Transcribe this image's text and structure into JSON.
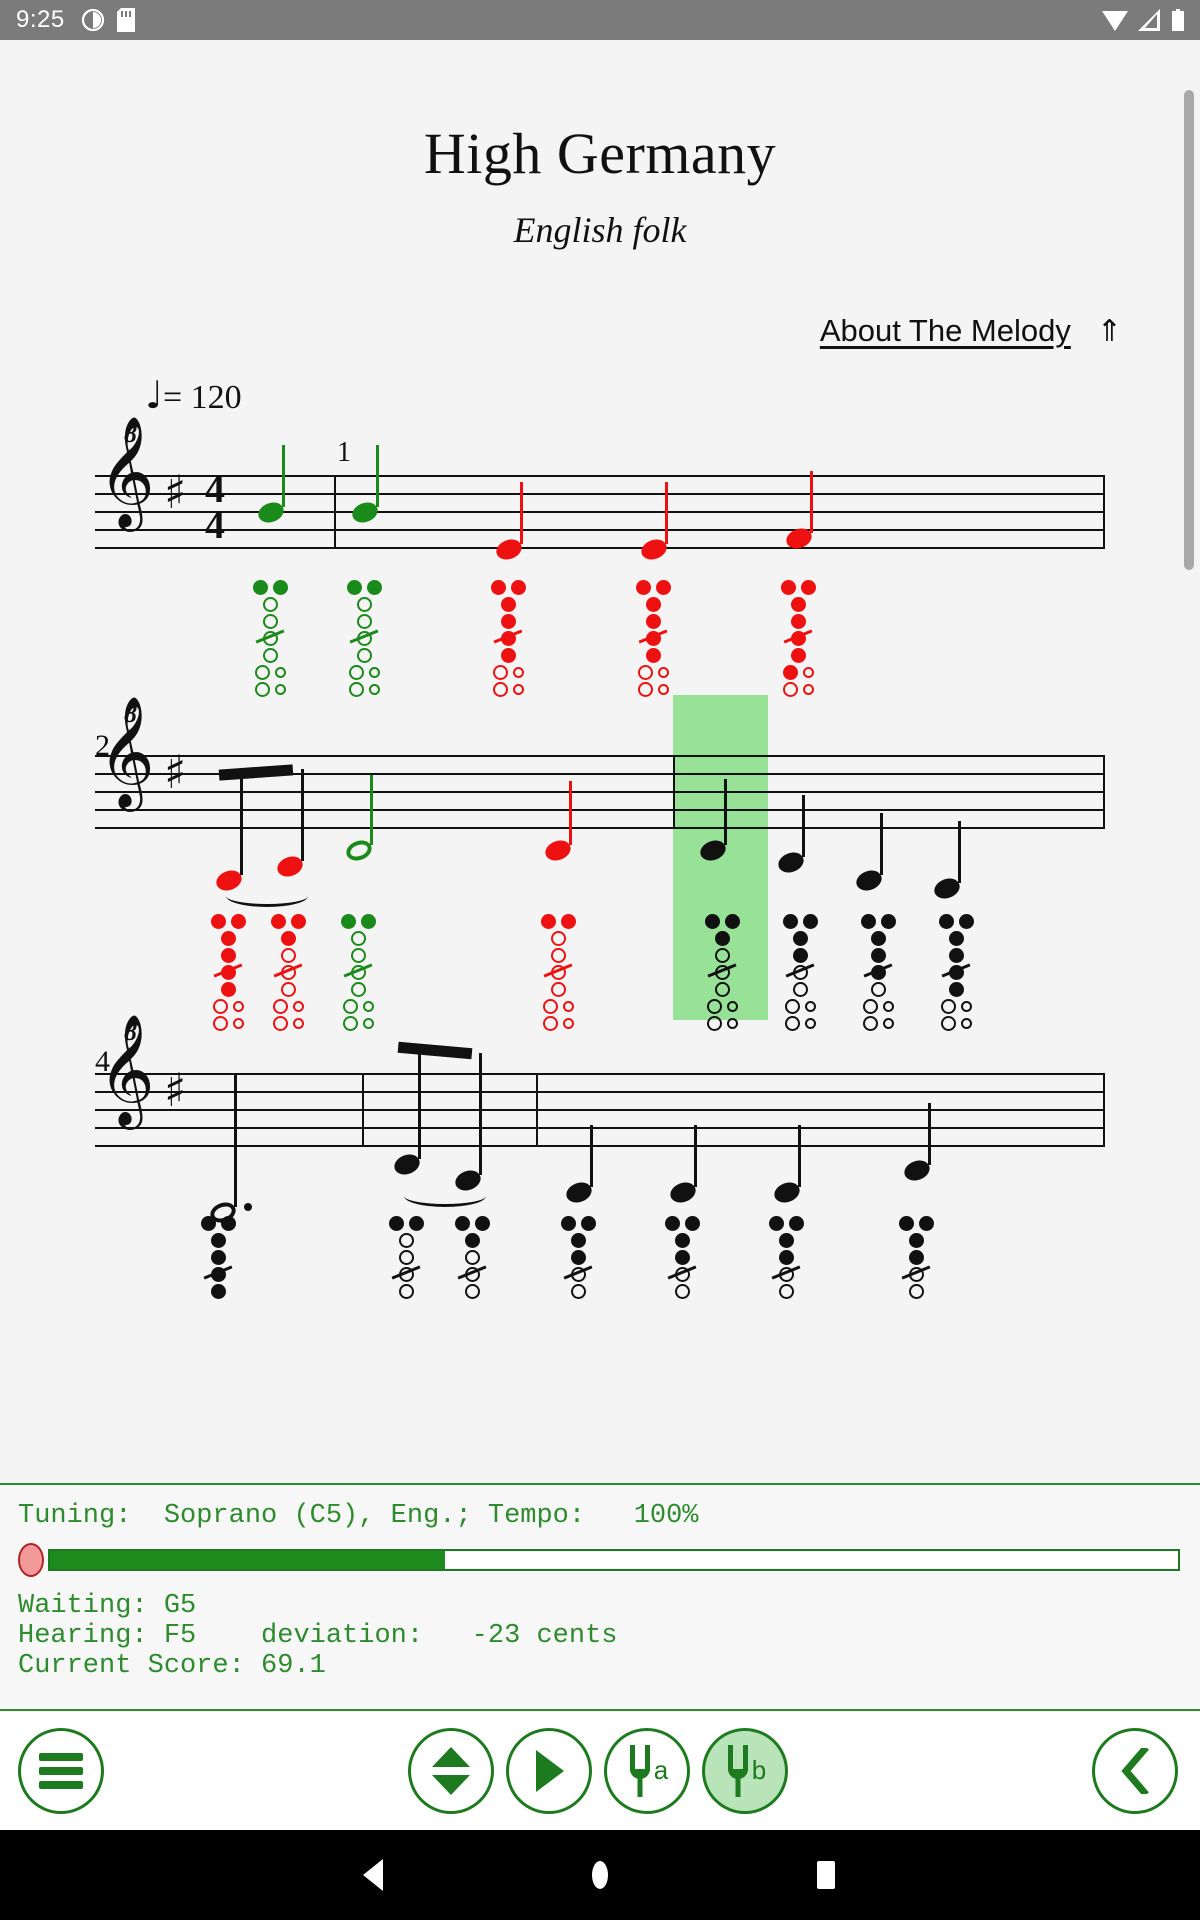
{
  "statusbar": {
    "time": "9:25",
    "left_icons": [
      "clock-icon",
      "sd-card-icon"
    ],
    "right_icons": [
      "wifi-icon",
      "signal-icon",
      "battery-icon"
    ]
  },
  "header": {
    "title": "High Germany",
    "subtitle": "English folk",
    "about_link": "About The Melody",
    "about_arrow": "⇑"
  },
  "score": {
    "tempo_label": "= 120",
    "tempo_note": "♩",
    "clef": "treble-8-clef",
    "key_signature": "one-sharp",
    "time_signature_top": "4",
    "time_signature_bottom": "4",
    "systems": [
      {
        "number": "",
        "measure_numbers": [
          "1"
        ]
      },
      {
        "number": "2",
        "measure_numbers": []
      },
      {
        "number": "4",
        "measure_numbers": []
      }
    ]
  },
  "status": {
    "tuning_line": "Tuning:  Soprano (C5), Eng.; Tempo:   100%",
    "waiting_line": "Waiting: G5",
    "hearing_line": "Hearing: F5    deviation:   -23 cents",
    "score_line": "Current Score: 69.1",
    "progress_percent": 35,
    "text_color": "#2e8b2e",
    "progress_fill_color": "#1e8b1e",
    "knob_color": "#f29a9a"
  },
  "toolbar": {
    "menu_button": "menu-button",
    "octave_button": "octave-updown-button",
    "play_button": "play-button",
    "fork_a_button": "tuning-fork-a-button",
    "fork_b_button": "tuning-fork-b-button",
    "fork_b_label": "b",
    "fork_a_label": "a",
    "back_button": "back-button",
    "accent_color": "#1e7a1e",
    "active_bg": "#b9e3b9"
  },
  "navbar": {
    "back": "android-back",
    "home": "android-home",
    "recents": "android-recents"
  },
  "highlight_color": "#8ee08e",
  "note_colors": {
    "correct": "#1a8a1a",
    "wrong": "#ee1111",
    "neutral": "#111111"
  }
}
